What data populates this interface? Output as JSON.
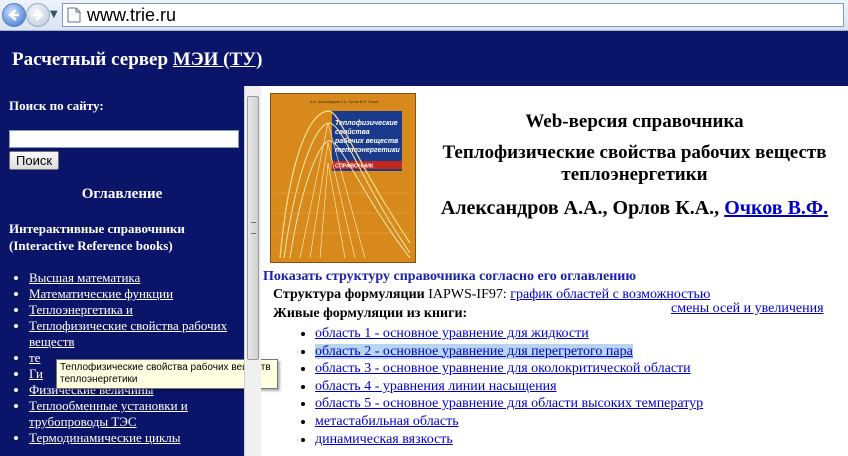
{
  "browser": {
    "url": "www.trie.ru"
  },
  "header": {
    "title_prefix": "Расчетный сервер ",
    "title_link": "МЭИ (ТУ)"
  },
  "sidebar": {
    "search_label": "Поиск по сайту:",
    "search_value": "",
    "search_button": "Поиск",
    "toc_title": "Оглавление",
    "ref_title": "Интерактивные справочники (Interactive Reference books)",
    "items": [
      {
        "label": "Высшая математика"
      },
      {
        "label": "Математические функции"
      },
      {
        "label": "Теплоэнергетика и"
      },
      {
        "label": "Теплофизические свойства рабочих веществ"
      },
      {
        "label": "те"
      },
      {
        "label": "Ги"
      },
      {
        "label": "Физические величины"
      },
      {
        "label": "Теплообменные установки и трубопроводы ТЭС"
      },
      {
        "label": "Термодинамические циклы"
      }
    ],
    "tooltip": "Теплофизические свойства рабочих веществ теплоэнергетики"
  },
  "main": {
    "heading1": "Web-версия справочника",
    "heading2": "Теплофизические свойства рабочих веществ теплоэнергетики",
    "authors_prefix": "Александров А.А., Орлов К.А., ",
    "authors_link": "Очков В.Ф.",
    "show_structure": "Показать структуру справочника согласно его оглавлению",
    "structure_label": "Структура формуляции",
    "structure_value": " IAPWS-IF97: ",
    "structure_link": "график областей с возможностью",
    "structure_link_cont": "смены осей и увеличения",
    "live_title": "Живые формуляции из книги:",
    "items": [
      {
        "label": "область 1 - основное уравнение для жидкости"
      },
      {
        "label": "область 2 - основное уравнение для перегретого пара"
      },
      {
        "label": "область 3 - основное уравнение для околокритической области"
      },
      {
        "label": "область 4 - уравнения линии насыщения"
      },
      {
        "label": "область 5 - основное уравнение для области высоких температур"
      },
      {
        "label": "метастабильная область"
      },
      {
        "label": "динамическая вязкость"
      }
    ]
  },
  "book": {
    "authors_small": "А.А. Александров К.А. Орлов В.Ф. Очков",
    "title_line1": "Теплофизические",
    "title_line2": "свойства",
    "title_line3": "рабочих веществ",
    "title_line4": "теплоэнергетики",
    "subtitle": "СПРАВОЧНИК",
    "colors": {
      "cover": "#d8891c",
      "title_band": "#1a3a8c",
      "curve": "#f6e08a"
    }
  }
}
